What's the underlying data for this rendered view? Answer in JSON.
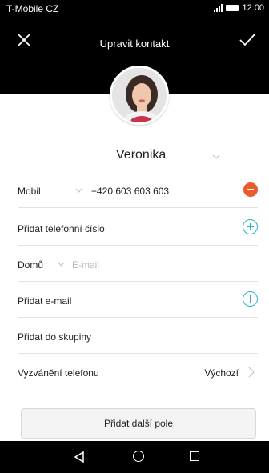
{
  "status_bar": {
    "carrier": "T-Mobile CZ",
    "time": "12:00",
    "signal_icon": "signal-icon",
    "battery_icon": "battery-icon"
  },
  "header": {
    "title": "Upravit kontakt",
    "close_icon": "close-icon",
    "confirm_icon": "checkmark-icon"
  },
  "contact": {
    "name": "Veronika"
  },
  "fields": {
    "mobile_label": "Mobil",
    "mobile_value": "+420 603 603 603",
    "add_phone": "Přidat telefonní číslo",
    "home_label": "Domů",
    "email_placeholder": "E-mail",
    "add_email": "Přidat e-mail",
    "add_group": "Přidat do skupiny",
    "ringtone_label": "Vyzvánění telefonu",
    "ringtone_value": "Výchozí"
  },
  "add_field_button": "Přidat další pole",
  "colors": {
    "accent": "#27b3c7",
    "remove": "#ea5a2b",
    "header_bg": "#000000"
  },
  "nav_bar": {
    "back_icon": "back-icon",
    "home_icon": "home-icon",
    "recent_icon": "recent-apps-icon"
  }
}
